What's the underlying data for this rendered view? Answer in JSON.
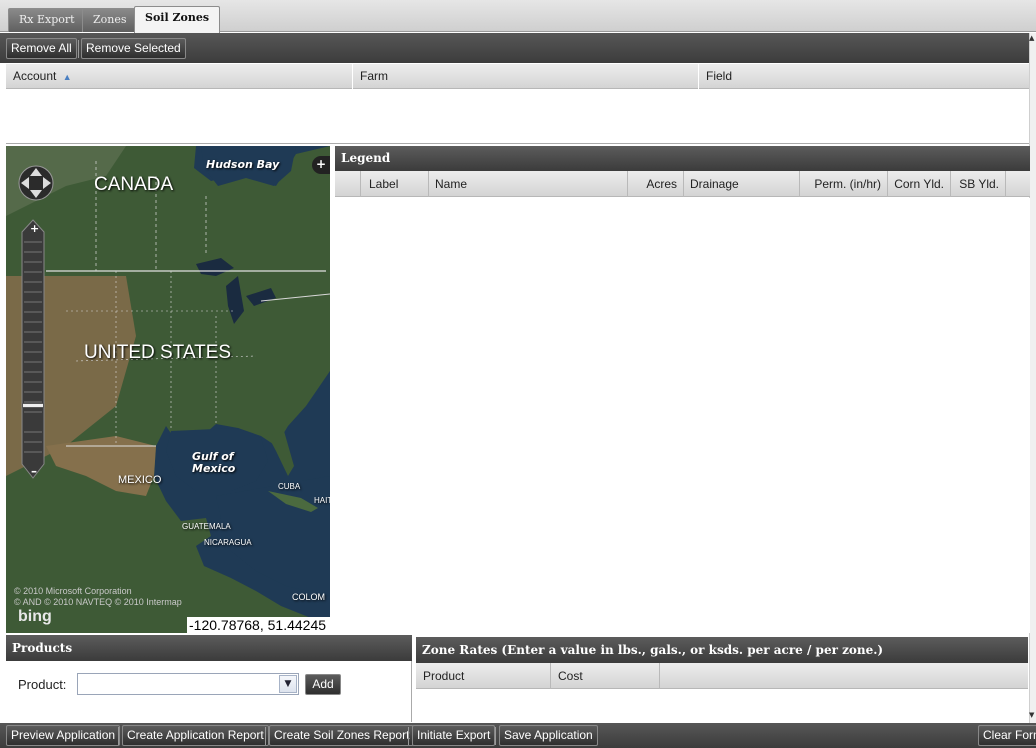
{
  "tabs": [
    {
      "label": "Rx Export"
    },
    {
      "label": "Zones"
    },
    {
      "label": "Soil Zones",
      "active": true
    }
  ],
  "toolbar": {
    "remove_all": "Remove All",
    "remove_selected": "Remove Selected"
  },
  "account_grid": {
    "columns": [
      "Account",
      "Farm",
      "Field"
    ],
    "sort_indicator": "▲",
    "rows": []
  },
  "map": {
    "labels": {
      "hudson_bay": "Hudson Bay",
      "canada": "CANADA",
      "united_states": "UNITED STATES",
      "gulf_of_mexico_1": "Gulf of",
      "gulf_of_mexico_2": "Mexico",
      "mexico": "MEXICO",
      "cuba": "CUBA",
      "haiti": "HAITI",
      "guatemala": "GUATEMALA",
      "nicaragua": "NICARAGUA",
      "colombia": "COLOM"
    },
    "copyright_1": "© 2010 Microsoft Corporation",
    "copyright_2": "© AND © 2010 NAVTEQ  © 2010 Intermap",
    "logo": "bing",
    "coordinates": "-120.78768, 51.44245",
    "zoom_level_fraction": 0.75,
    "colors": {
      "land": "#3e5a36",
      "water": "#1f3a55"
    }
  },
  "legend": {
    "title": "Legend",
    "columns": [
      "Label",
      "Name",
      "Acres",
      "Drainage",
      "Perm. (in/hr)",
      "Corn Yld.",
      "SB Yld."
    ],
    "rows": []
  },
  "products": {
    "title": "Products",
    "product_label": "Product:",
    "product_value": "",
    "add_label": "Add"
  },
  "zone_rates": {
    "title": "Zone Rates (Enter a value in lbs., gals., or ksds. per acre / per zone.)",
    "columns": [
      "Product",
      "Cost"
    ],
    "rows": []
  },
  "bottom_actions": {
    "preview": "Preview Application",
    "create_report": "Create Application Report",
    "create_soil_report": "Create Soil Zones Report",
    "initiate_export": "Initiate Export",
    "save": "Save Application",
    "clear": "Clear Form"
  }
}
